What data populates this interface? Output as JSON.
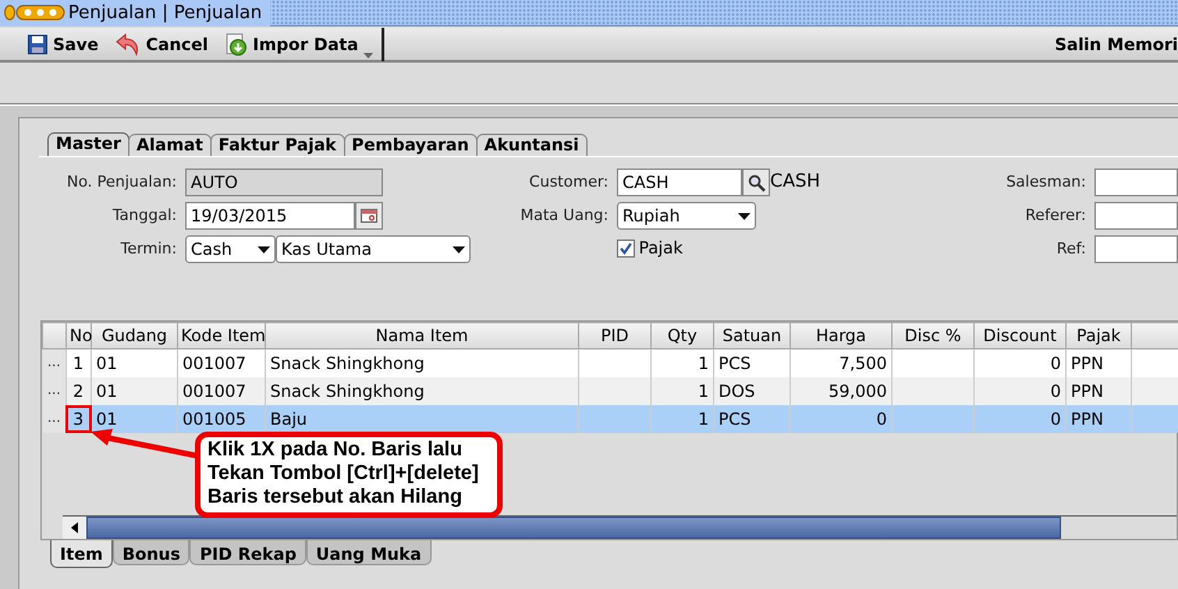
{
  "window": {
    "title": "Penjualan | Penjualan"
  },
  "toolbar": {
    "buttons": [
      {
        "kind": "save",
        "label": "Save"
      },
      {
        "kind": "cancel",
        "label": "Cancel"
      },
      {
        "kind": "import",
        "label": "Impor Data"
      }
    ],
    "right_label": "Salin Memori"
  },
  "tabs": [
    {
      "label": "Master",
      "selected": true
    },
    {
      "label": "Alamat",
      "selected": false
    },
    {
      "label": "Faktur Pajak",
      "selected": false
    },
    {
      "label": "Pembayaran",
      "selected": false
    },
    {
      "label": "Akuntansi",
      "selected": false
    }
  ],
  "form": {
    "no_penjualan": {
      "label": "No. Penjualan:",
      "value": "AUTO"
    },
    "tanggal": {
      "label": "Tanggal:",
      "value": "19/03/2015"
    },
    "termin": {
      "label": "Termin:",
      "value": "Cash",
      "account": "Kas Utama"
    },
    "customer": {
      "label": "Customer:",
      "value": "CASH",
      "name": "CASH"
    },
    "mata_uang": {
      "label": "Mata Uang:",
      "value": "Rupiah"
    },
    "pajak": {
      "label": "Pajak",
      "checked": true
    },
    "salesman": {
      "label": "Salesman:"
    },
    "referer": {
      "label": "Referer:"
    },
    "ref": {
      "label": "Ref:"
    }
  },
  "table": {
    "columns": [
      "No",
      "Gudang",
      "Kode Item",
      "Nama Item",
      "PID",
      "Qty",
      "Satuan",
      "Harga",
      "Disc %",
      "Discount",
      "Pajak"
    ],
    "rows": [
      {
        "selected": false,
        "handle": "...",
        "cells": [
          "1",
          "01",
          "001007",
          "Snack Shingkhong",
          "",
          "1",
          "PCS",
          "7,500",
          "",
          "0",
          "PPN"
        ]
      },
      {
        "selected": false,
        "handle": "...",
        "cells": [
          "2",
          "01",
          "001007",
          "Snack Shingkhong",
          "",
          "1",
          "DOS",
          "59,000",
          "",
          "0",
          "PPN"
        ]
      },
      {
        "selected": true,
        "handle": "...",
        "cells": [
          "3",
          "01",
          "001005",
          "Baju",
          "",
          "1",
          "PCS",
          "0",
          "",
          "0",
          "PPN"
        ]
      }
    ]
  },
  "bottom_tabs": [
    {
      "label": "Item",
      "selected": true
    },
    {
      "label": "Bonus",
      "selected": false
    },
    {
      "label": "PID Rekap",
      "selected": false
    },
    {
      "label": "Uang Muka",
      "selected": false
    }
  ],
  "callout": {
    "lines": [
      "Klik 1X pada No. Baris lalu",
      "Tekan Tombol [Ctrl]+[delete]",
      "Baris tersebut akan Hilang"
    ]
  }
}
